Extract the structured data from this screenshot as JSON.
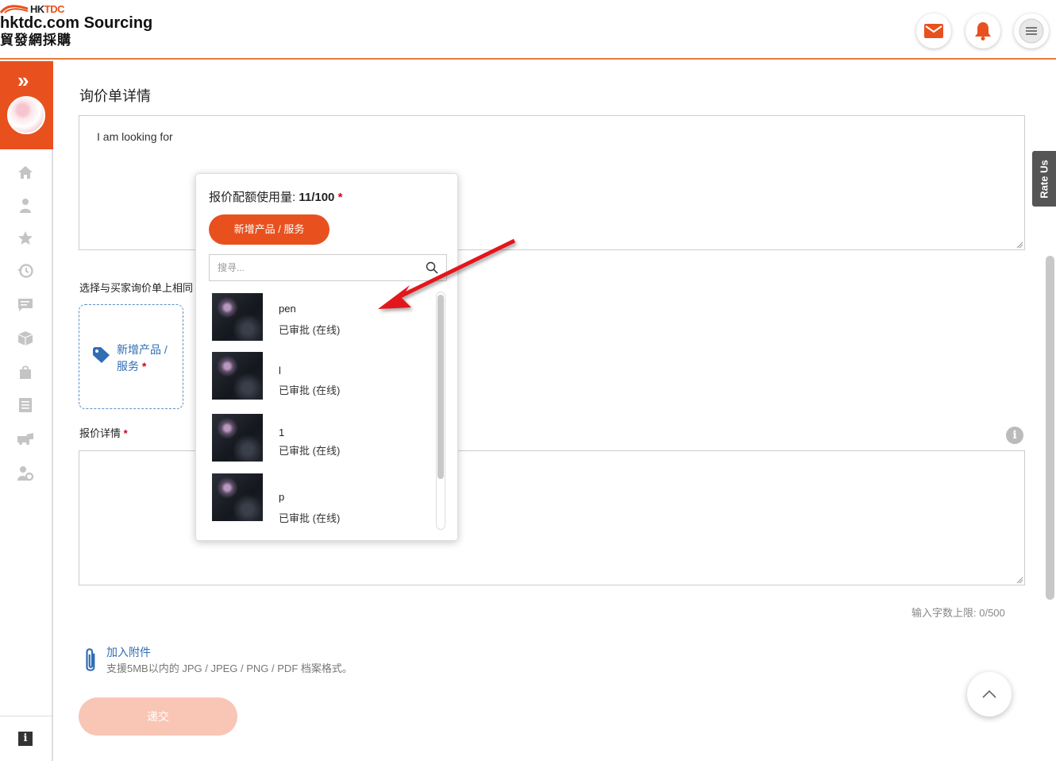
{
  "header": {
    "brand_short": "HKTDC",
    "brand_hk": "HK",
    "brand_tdc": "TDC",
    "brand_main": "hktdc.com Sourcing",
    "brand_sub": "貿發網採購",
    "colors": {
      "accent": "#e8511e",
      "link": "#2f6db5"
    }
  },
  "sidebar": {
    "expand_glyph": "»",
    "info_glyph": "i",
    "icons": [
      "home-icon",
      "user-icon",
      "star-icon",
      "history-icon",
      "message-icon",
      "box-icon",
      "bag-icon",
      "list-icon",
      "vehicle-icon",
      "user-settings-icon"
    ]
  },
  "main": {
    "section_title": "询价单详情",
    "inquiry_text": "I am looking for",
    "select_label": "选择与买家询价单上相同",
    "add_product_label": "新增产品 / 服务",
    "add_product_label_line1": "新增产品 /",
    "add_product_label_line2": "服务",
    "required_mark": "*",
    "quote_label": "报价详情",
    "char_limit": "输入字数上限: 0/500",
    "attach_label": "加入附件",
    "attach_hint": "支援5MB以内的 JPG / JPEG / PNG / PDF 档案格式。",
    "submit_label": "递交",
    "rate_us": "Rate Us",
    "info_glyph": "i"
  },
  "popup": {
    "quota_label": "报价配额使用量:",
    "quota_value": "11/100",
    "add_button": "新增产品 / 服务",
    "search_placeholder": "搜寻...",
    "items": [
      {
        "name": "pen",
        "status": "已审批 (在线)"
      },
      {
        "name": "l",
        "status": "已审批 (在线)"
      },
      {
        "name": "1",
        "status": "已审批 (在线)"
      },
      {
        "name": "p",
        "status": "已审批 (在线)"
      }
    ]
  }
}
